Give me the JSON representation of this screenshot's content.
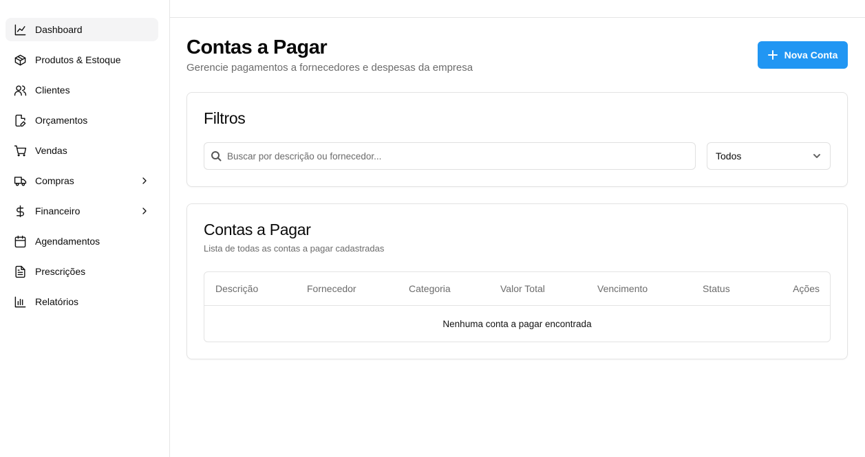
{
  "sidebar": {
    "items": [
      {
        "label": "Dashboard",
        "icon": "chart-line-icon",
        "active": true
      },
      {
        "label": "Produtos & Estoque",
        "icon": "package-icon"
      },
      {
        "label": "Clientes",
        "icon": "users-icon"
      },
      {
        "label": "Orçamentos",
        "icon": "file-edit-icon"
      },
      {
        "label": "Vendas",
        "icon": "shopping-cart-icon"
      },
      {
        "label": "Compras",
        "icon": "truck-icon",
        "expandable": true
      },
      {
        "label": "Financeiro",
        "icon": "dollar-sign-icon",
        "expandable": true
      },
      {
        "label": "Agendamentos",
        "icon": "calendar-icon"
      },
      {
        "label": "Prescrições",
        "icon": "file-text-icon"
      },
      {
        "label": "Relatórios",
        "icon": "bar-chart-icon"
      }
    ]
  },
  "header": {
    "title": "Contas a Pagar",
    "subtitle": "Gerencie pagamentos a fornecedores e despesas da empresa",
    "new_button_label": "Nova Conta"
  },
  "filters": {
    "title": "Filtros",
    "search_placeholder": "Buscar por descrição ou fornecedor...",
    "status_value": "Todos"
  },
  "list": {
    "title": "Contas a Pagar",
    "description": "Lista de todas as contas a pagar cadastradas",
    "columns": [
      "Descrição",
      "Fornecedor",
      "Categoria",
      "Valor Total",
      "Vencimento",
      "Status",
      "Ações"
    ],
    "empty_message": "Nenhuma conta a pagar encontrada"
  },
  "colors": {
    "primary": "#2196f3",
    "active_nav_bg": "#f4f4f5",
    "border": "#e3e3e3"
  }
}
